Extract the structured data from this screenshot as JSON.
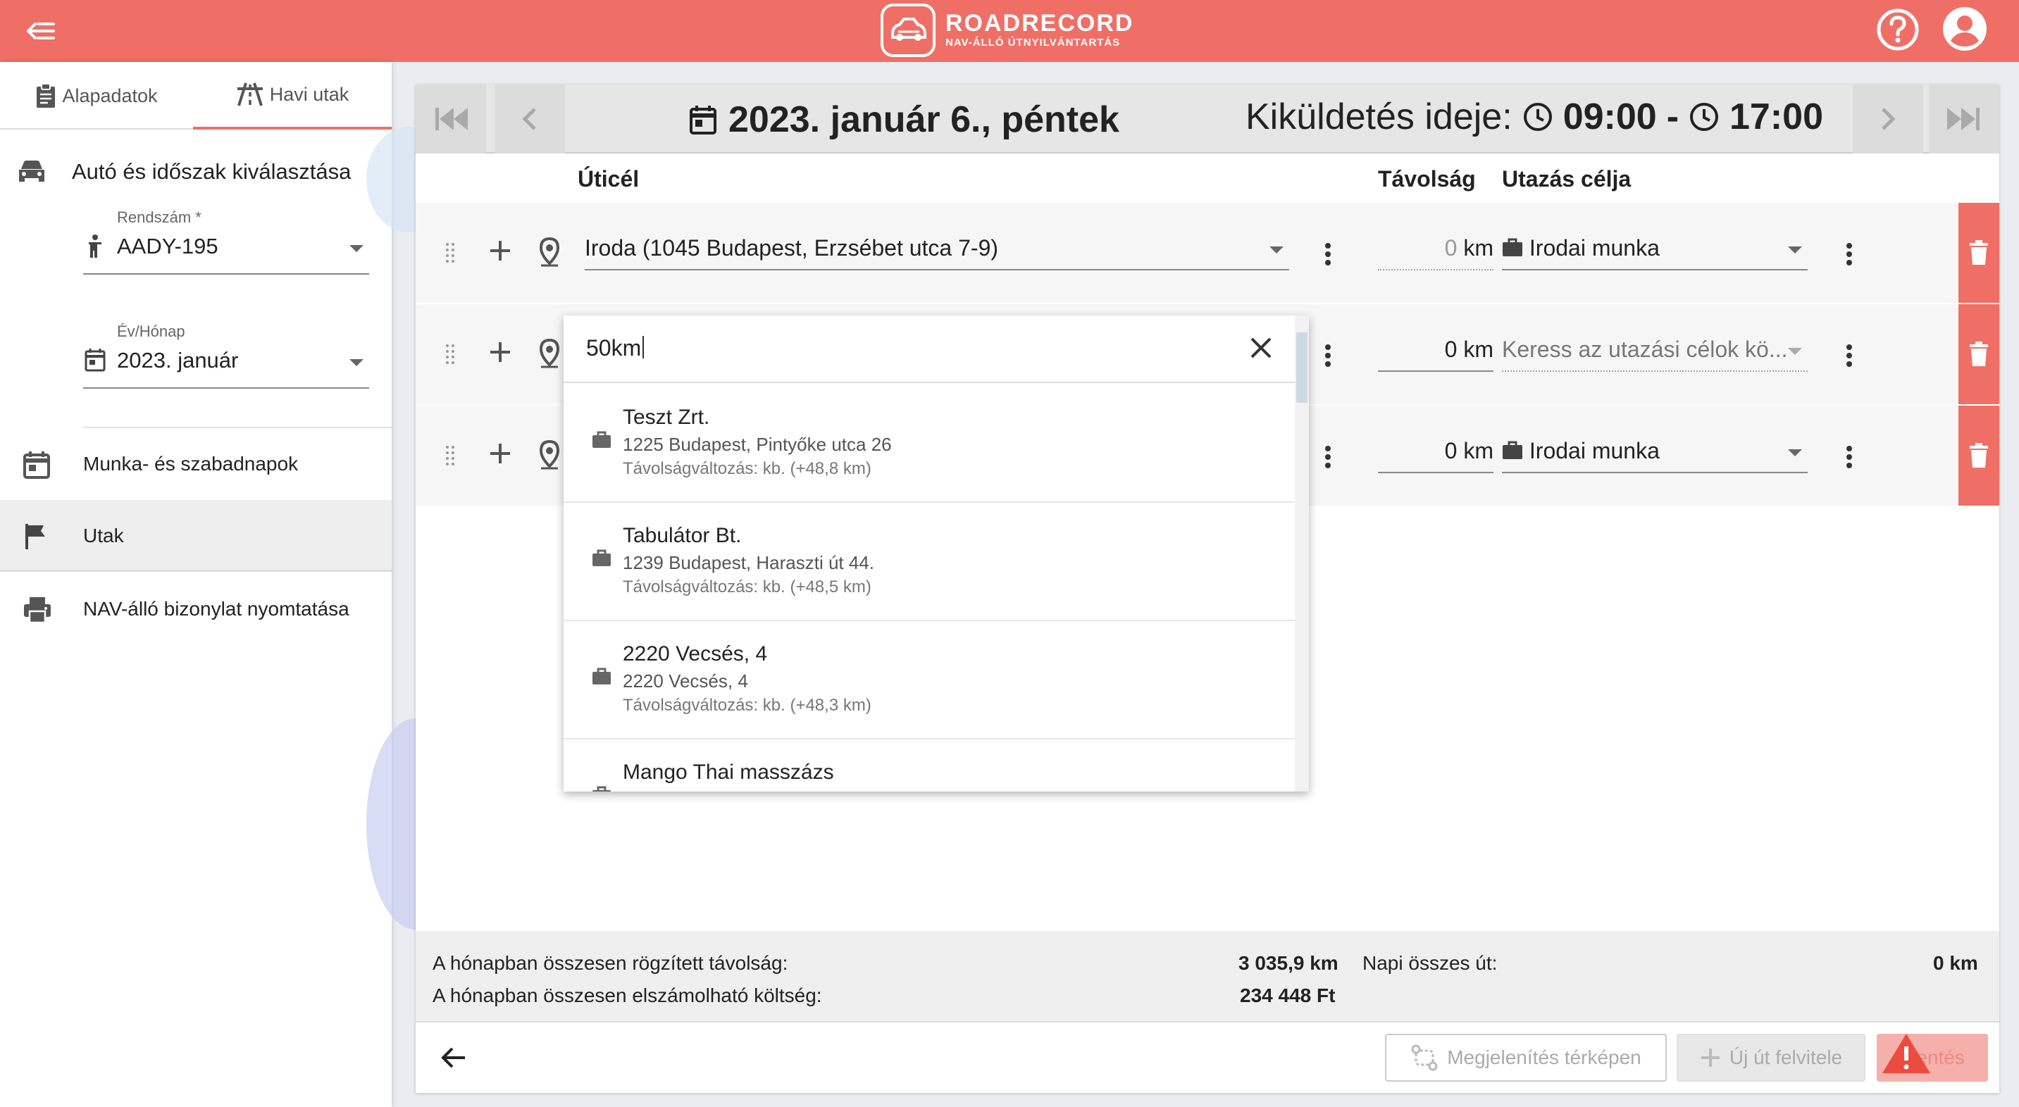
{
  "app": {
    "name": "ROADRECORD",
    "subtitle": "NAV-ÁLLÓ ÚTNYILVÁNTARTÁS",
    "colors": {
      "brand": "#ef6f66",
      "text": "#222222",
      "muted": "#888888"
    }
  },
  "sidebar": {
    "tabs": [
      {
        "label": "Alapadatok",
        "icon": "clipboard-icon"
      },
      {
        "label": "Havi utak",
        "icon": "road-icon"
      }
    ],
    "section_title": "Autó és időszak kiválasztása",
    "plate": {
      "label": "Rendszám *",
      "value": "AADY-195"
    },
    "month": {
      "label": "Év/Hónap",
      "value": "2023. január"
    },
    "nav": [
      {
        "label": "Munka- és szabadnapok",
        "icon": "calendar-icon"
      },
      {
        "label": "Utak",
        "icon": "flag-icon"
      },
      {
        "label": "NAV-álló bizonylat nyomtatása",
        "icon": "printer-icon"
      }
    ]
  },
  "main": {
    "date": "2023. január 6., péntek",
    "send_label": "Kiküldetés ideje:",
    "send_from": "09:00",
    "send_sep": "-",
    "send_to": "17:00",
    "columns": {
      "dest": "Úticél",
      "dist": "Távolság",
      "purpose": "Utazás célja"
    },
    "rows": [
      {
        "dest": "Iroda (1045 Budapest, Erzsébet utca 7-9)",
        "dist": "0",
        "unit": "km",
        "purpose": "Irodai munka"
      },
      {
        "dest": "",
        "dist": "0",
        "unit": "km",
        "purpose_placeholder": "Keress az utazási célok kö..."
      },
      {
        "dest": "",
        "dist": "0",
        "unit": "km",
        "purpose": "Irodai munka"
      }
    ],
    "search": {
      "value": "50km",
      "results": [
        {
          "name": "Teszt Zrt.",
          "address": "1225 Budapest, Pintyőke utca 26",
          "delta": "Távolságváltozás: kb. (+48,8 km)"
        },
        {
          "name": "Tabulátor Bt.",
          "address": "1239 Budapest, Haraszti út 44.",
          "delta": "Távolságváltozás: kb. (+48,5 km)"
        },
        {
          "name": "2220 Vecsés, 4",
          "address": "2220 Vecsés, 4",
          "delta": "Távolságváltozás: kb. (+48,3 km)"
        },
        {
          "name": "Mango Thai masszázs",
          "address": "",
          "delta": ""
        }
      ]
    },
    "summary": {
      "recorded_label": "A hónapban összesen rögzített távolság:",
      "recorded_value": "3 035,9 km",
      "cost_label": "A hónapban összesen elszámolható költség:",
      "cost_value": "234 448 Ft",
      "daily_label": "Napi összes út:",
      "daily_value": "0 km"
    },
    "buttons": {
      "map": "Megjelenítés térképen",
      "new_trip": "Új út felvitele",
      "save": "Mentés"
    }
  }
}
